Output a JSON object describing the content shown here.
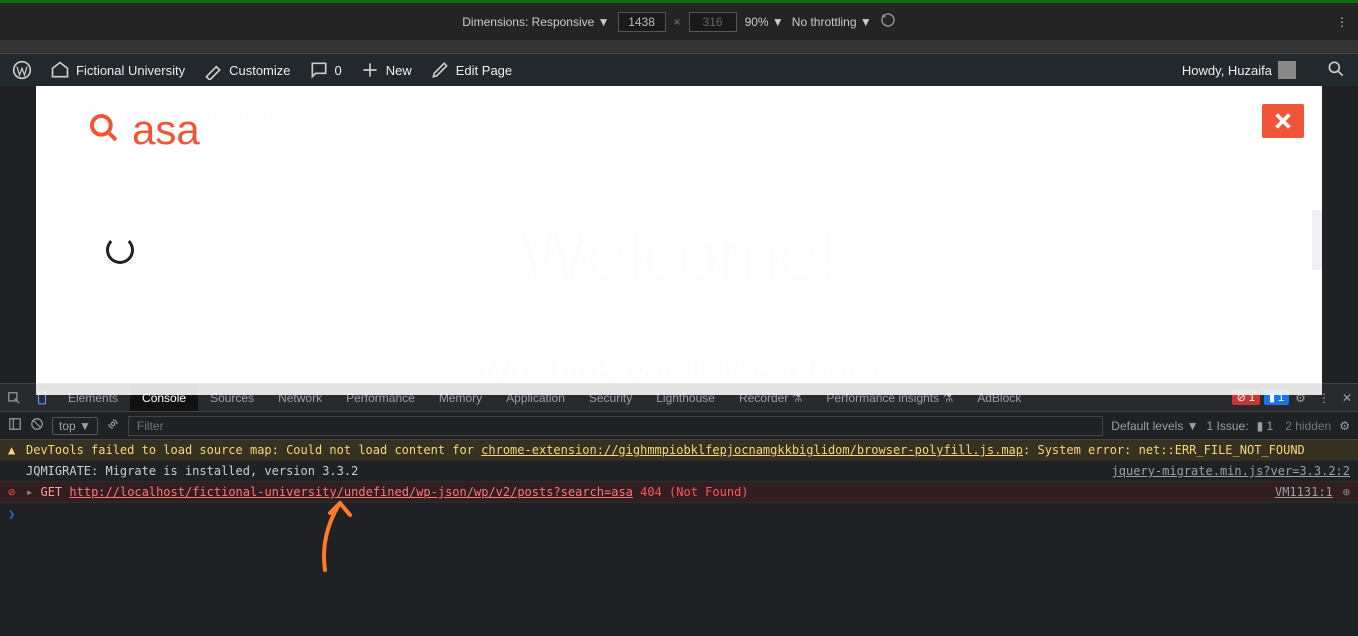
{
  "devtools_top": {
    "dimensions_label": "Dimensions: Responsive ▼",
    "width": "1438",
    "height": "316",
    "zoom": "90% ▼",
    "throttling": "No throttling ▼"
  },
  "wp_bar": {
    "site_name": "Fictional University",
    "customize": "Customize",
    "comments": "0",
    "new": "New",
    "edit": "Edit Page",
    "howdy": "Howdy, Huzaifa"
  },
  "page": {
    "logo_text": "Fictional University",
    "nav": [
      "About Us",
      "Programs",
      "Events",
      "Campuses",
      "Blog"
    ],
    "welcome": "Welcome!",
    "subtitle": "We think you'll like it here",
    "search_value": "asa"
  },
  "devtools": {
    "tabs": [
      "Elements",
      "Console",
      "Sources",
      "Network",
      "Performance",
      "Memory",
      "Application",
      "Security",
      "Lighthouse",
      "Recorder ⚗",
      "Performance insights ⚗",
      "AdBlock"
    ],
    "active_tab": "Console",
    "error_count": "1",
    "info_count": "1",
    "context": "top ▼",
    "filter_placeholder": "Filter",
    "levels": "Default levels ▼",
    "issues_label": "1 Issue:",
    "issues_count": "1",
    "hidden": "2 hidden"
  },
  "console": {
    "warn": {
      "prefix": "DevTools failed to load source map: Could not load content for ",
      "link": "chrome-extension://gighmmpiobklfepjocnamgkkbiglidom/browser-polyfill.js.map",
      "suffix": ": System error: net::ERR_FILE_NOT_FOUND"
    },
    "log1": {
      "msg": "JQMIGRATE: Migrate is installed, version 3.3.2",
      "src": "jquery-migrate.min.js?ver=3.3.2:2"
    },
    "err": {
      "method": "GET",
      "url": "http://localhost/fictional-university/undefined/wp-json/wp/v2/posts?search=asa",
      "status": "404 (Not Found)",
      "src": "VM1131:1"
    }
  }
}
